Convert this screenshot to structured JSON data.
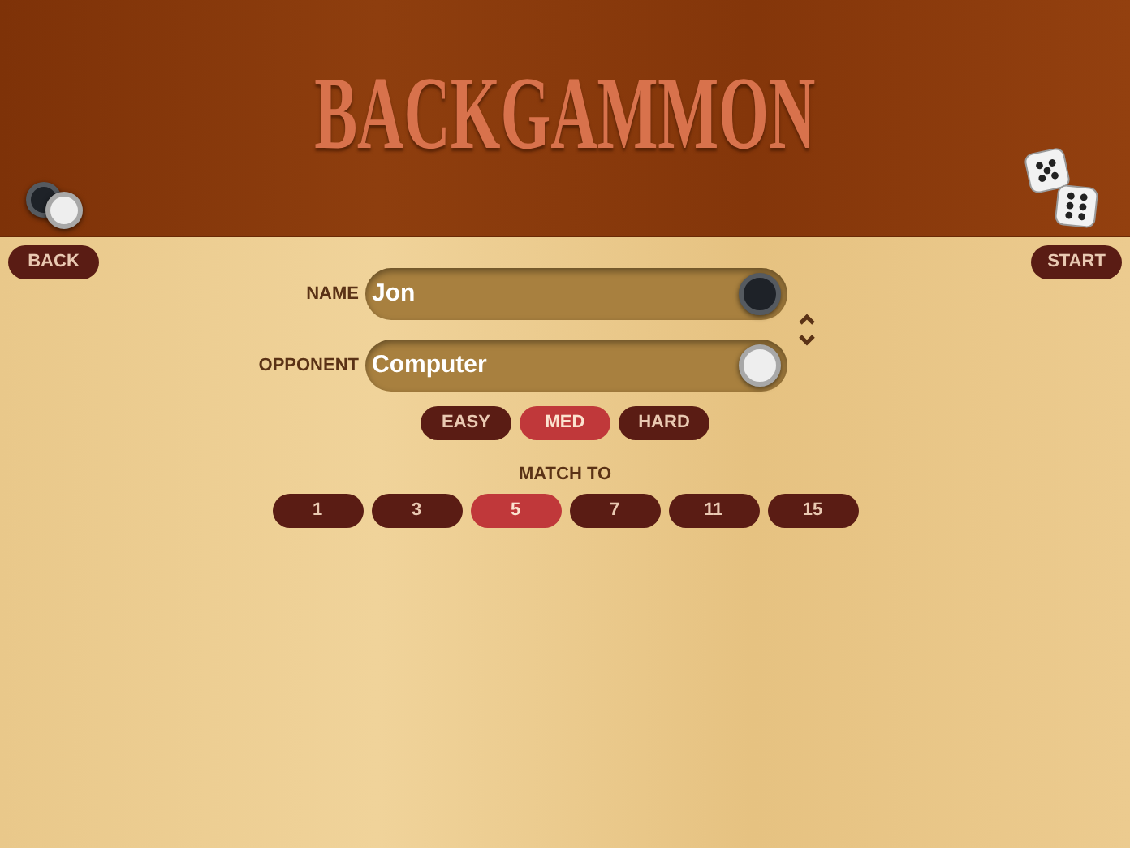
{
  "title": "BACKGAMMON",
  "back_button": "BACK",
  "start_button": "START",
  "players": [
    {
      "label": "NAME",
      "value": "Jon",
      "kind": "black"
    },
    {
      "label": "OPPONENT",
      "value": "Computer",
      "kind": "white"
    }
  ],
  "difficulty": [
    {
      "label": "EASY",
      "selected": false
    },
    {
      "label": "MED",
      "selected": true
    },
    {
      "label": "HARD",
      "selected": false
    }
  ],
  "match_to": {
    "label": "MATCH TO",
    "options": [
      {
        "label": "1",
        "selected": false
      },
      {
        "label": "3",
        "selected": false
      },
      {
        "label": "5",
        "selected": true
      },
      {
        "label": "7",
        "selected": false
      },
      {
        "label": "11",
        "selected": false
      },
      {
        "label": "15",
        "selected": false
      }
    ]
  }
}
